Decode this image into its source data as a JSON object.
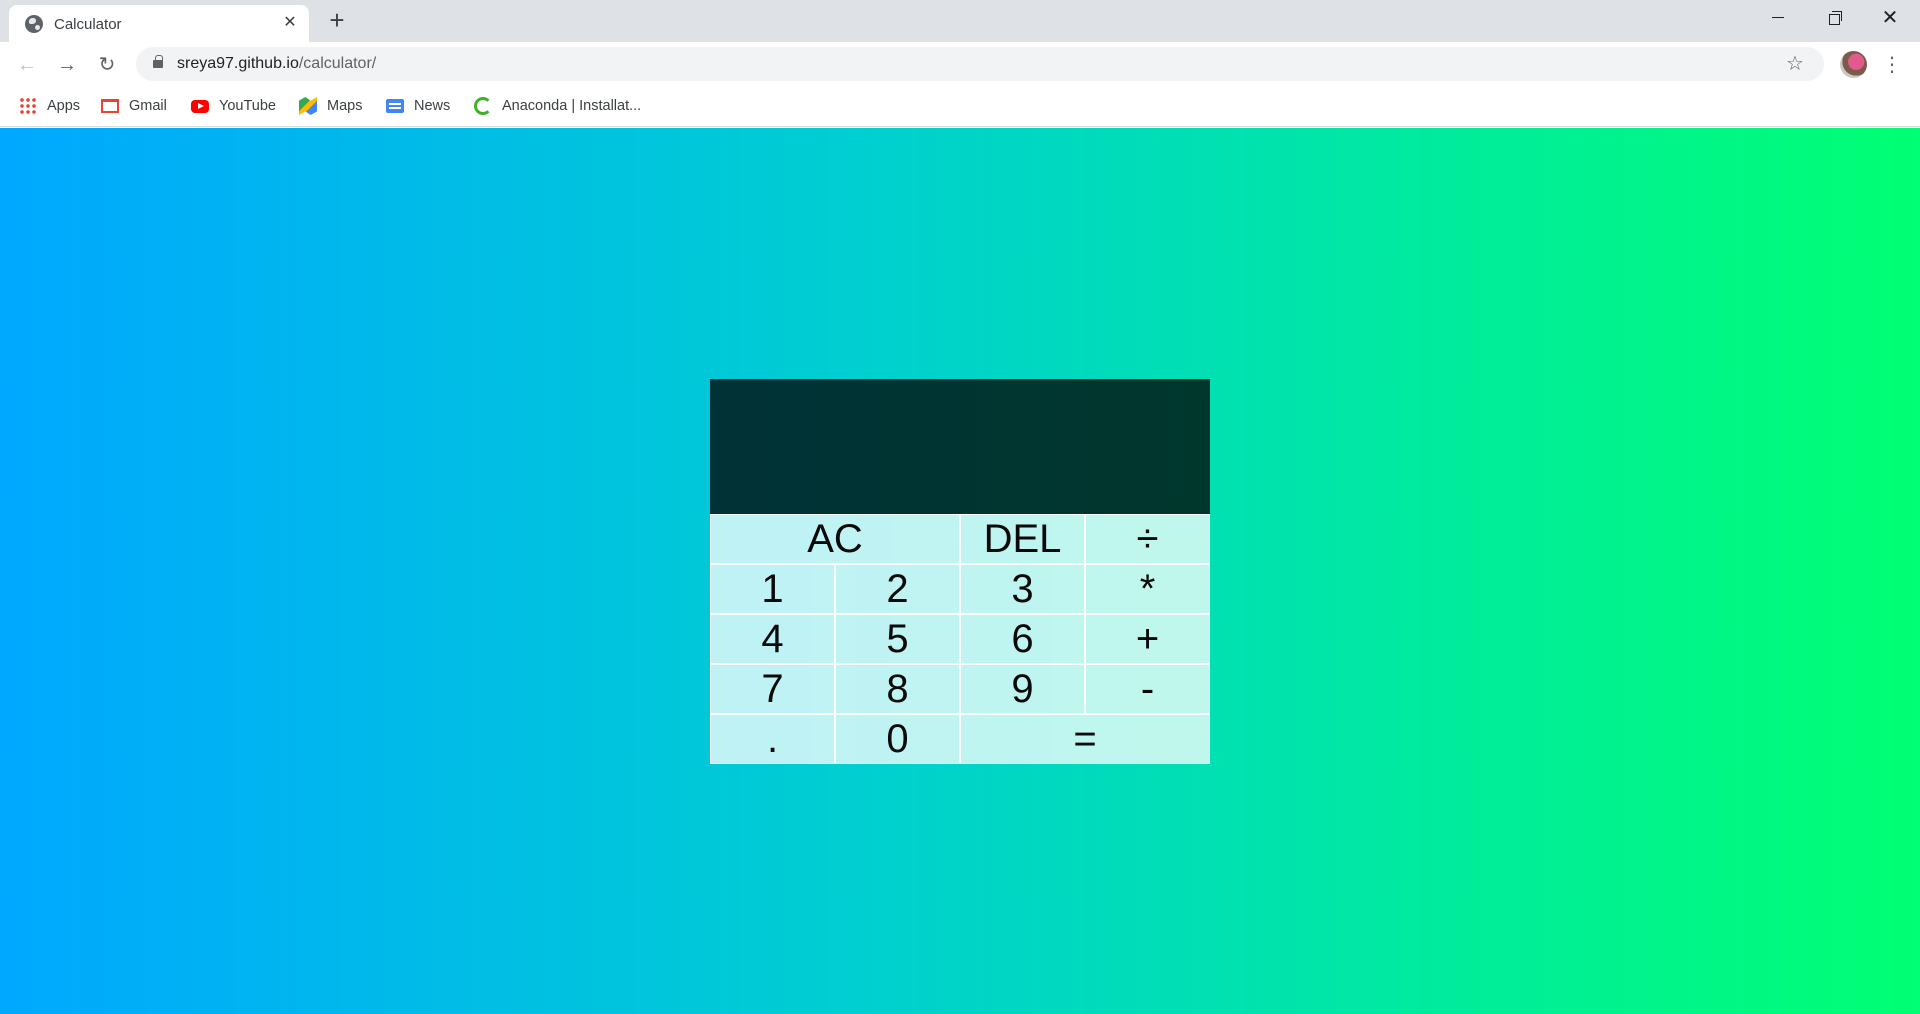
{
  "browser": {
    "tab": {
      "title": "Calculator",
      "favicon": "globe-icon",
      "close": "✕"
    },
    "new_tab": "+",
    "window_controls": {
      "close": "✕"
    },
    "nav": {
      "back": "←",
      "forward": "→",
      "reload": "↻"
    },
    "address": {
      "host": "sreya97.github.io",
      "path": "/calculator/"
    },
    "star": "☆",
    "menu": "⋮",
    "bookmarks": [
      {
        "label": "Apps",
        "icon": "apps-grid-icon"
      },
      {
        "label": "Gmail",
        "icon": "gmail-icon"
      },
      {
        "label": "YouTube",
        "icon": "youtube-icon"
      },
      {
        "label": "Maps",
        "icon": "maps-icon"
      },
      {
        "label": "News",
        "icon": "news-icon"
      },
      {
        "label": "Anaconda | Installat...",
        "icon": "anaconda-icon"
      }
    ]
  },
  "calculator": {
    "display": {
      "previous": "",
      "current": ""
    },
    "keys": {
      "ac": "AC",
      "del": "DEL",
      "divide": "÷",
      "one": "1",
      "two": "2",
      "three": "3",
      "multiply": "*",
      "four": "4",
      "five": "5",
      "six": "6",
      "plus": "+",
      "seven": "7",
      "eight": "8",
      "nine": "9",
      "minus": "-",
      "dot": ".",
      "zero": "0",
      "equals": "="
    }
  },
  "colors": {
    "display_bg": "#00323a",
    "gradient_start": "#00a8ff",
    "gradient_end": "#00ff73",
    "key_bg": "#bff2f0"
  }
}
